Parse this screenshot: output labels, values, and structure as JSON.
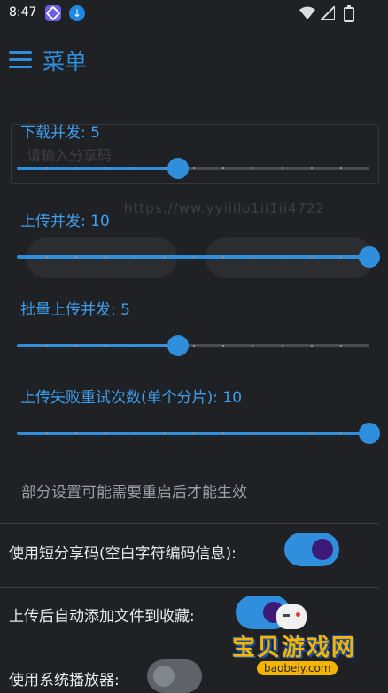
{
  "status_bar": {
    "time": "8:47"
  },
  "app_bar": {
    "title": "菜单"
  },
  "background": {
    "input_placeholder": "请输入分享码",
    "code_text": "https://ww.yyiiilo1ii1ii4722"
  },
  "sliders": [
    {
      "label": "下载并发: 5",
      "value": 5,
      "min": 1,
      "max": 10,
      "thumb_fraction": 0.457
    },
    {
      "label": "上传并发: 10",
      "value": 10,
      "min": 1,
      "max": 10,
      "thumb_fraction": 1.0
    },
    {
      "label": "批量上传并发: 5",
      "value": 5,
      "min": 1,
      "max": 10,
      "thumb_fraction": 0.457
    },
    {
      "label": "上传失败重试次数(单个分片): 10",
      "value": 10,
      "min": 1,
      "max": 10,
      "thumb_fraction": 1.0
    }
  ],
  "note": "部分设置可能需要重启后才能生效",
  "preferences": [
    {
      "label": "使用短分享码(空白字符编码信息):",
      "checked": true
    },
    {
      "label": "上传后自动添加文件到收藏:",
      "checked": true
    },
    {
      "label": "使用系统播放器:",
      "checked": false
    }
  ],
  "watermark": {
    "brand": "宝贝游戏网",
    "url": "baobeiy.com"
  },
  "colors": {
    "accent": "#2f8fdd",
    "background": "#202124",
    "knob_on": "#3b1a78"
  }
}
